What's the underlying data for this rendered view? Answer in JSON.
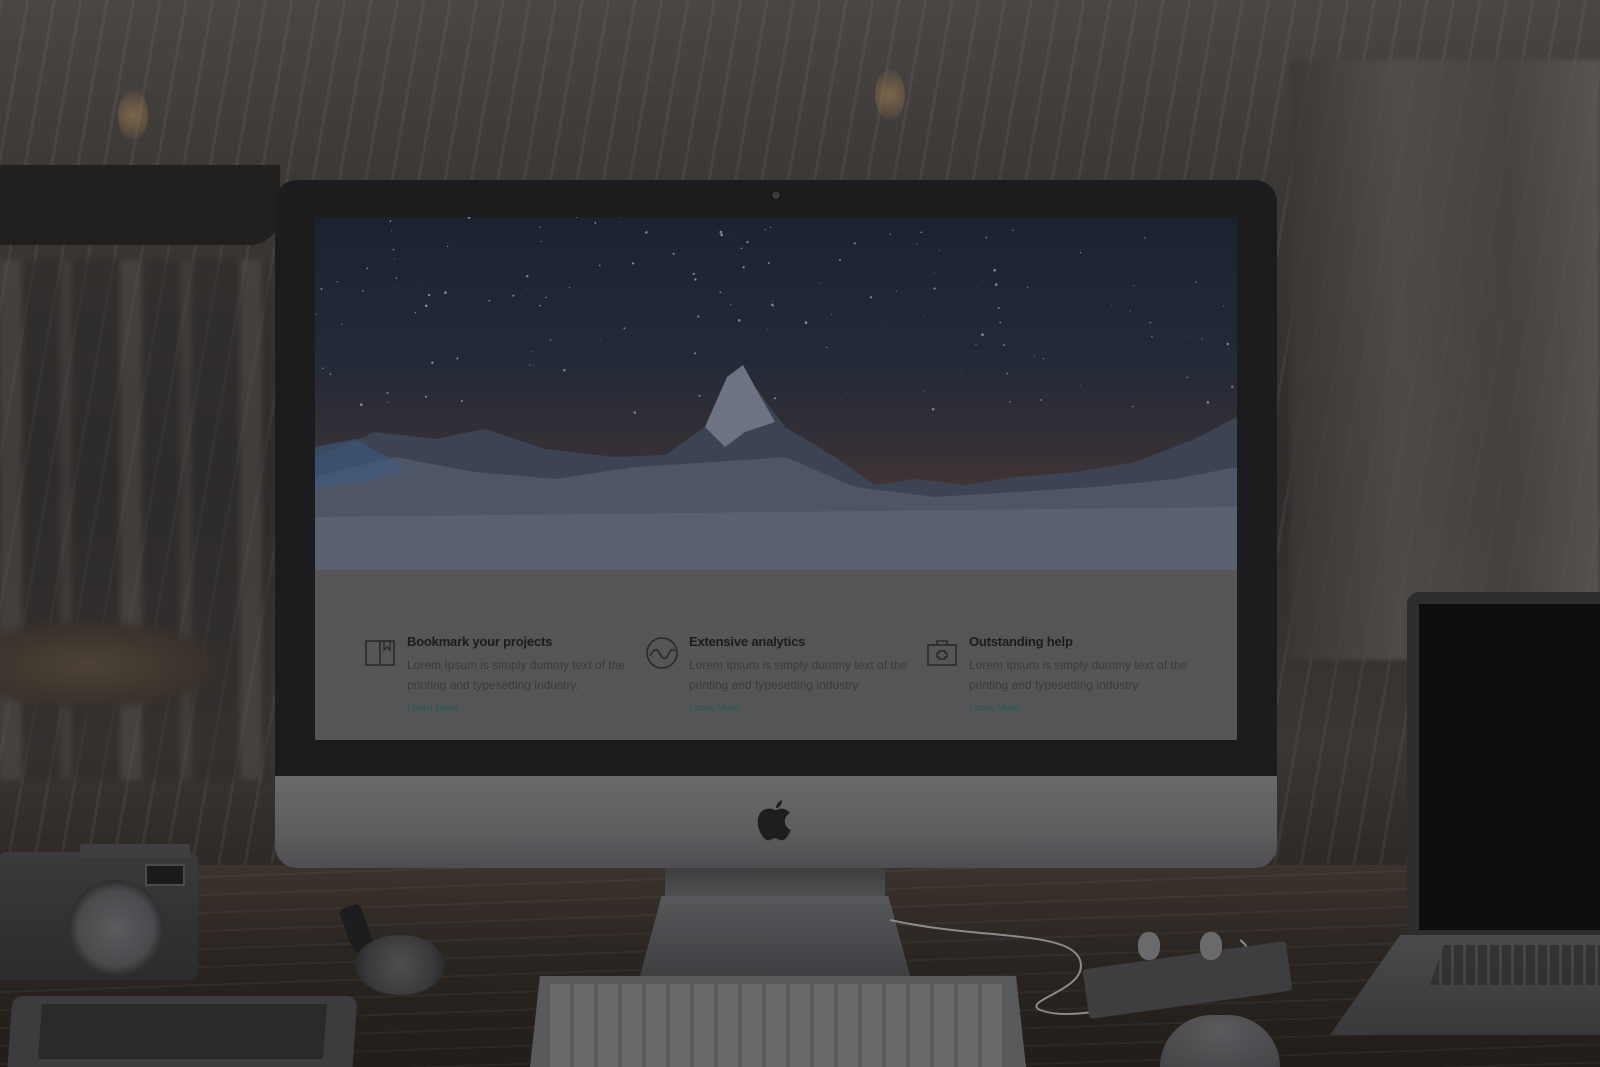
{
  "hero": {
    "image": "night-mountain-peak-starry-sky"
  },
  "features": [
    {
      "icon": "bookmark-book-icon",
      "title": "Bookmark your projects",
      "description": "Lorem Ipsum is simply dummy text of the printing and typesetting industry.",
      "link": "Learn More"
    },
    {
      "icon": "analytics-wave-icon",
      "title": "Extensive analytics",
      "description": "Lorem Ipsum is simply dummy text of the printing and typesetting industry.",
      "link": "Learn More"
    },
    {
      "icon": "first-aid-kit-icon",
      "title": "Outstanding help",
      "description": "Lorem Ipsum is simply dummy text of the printing and typesetting industry.",
      "link": "Learn More"
    }
  ],
  "colors": {
    "link": "#1f5e4f",
    "features_bg": "#555557"
  }
}
